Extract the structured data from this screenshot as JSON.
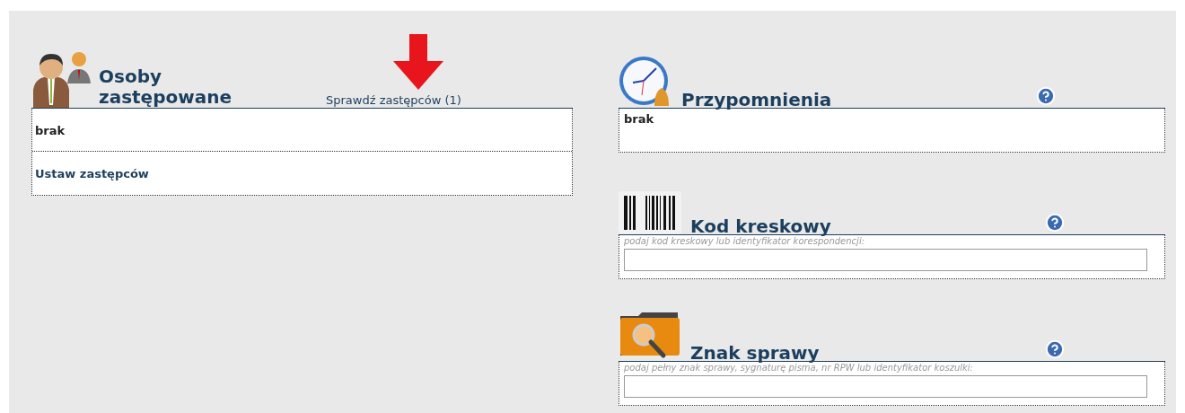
{
  "substitutes": {
    "title": "Osoby zastępowane",
    "check_link": "Sprawdź zastępców (1)",
    "rows": [
      {
        "kind": "text",
        "text": "brak"
      },
      {
        "kind": "link",
        "text": "Ustaw zastępców"
      }
    ]
  },
  "sections": [
    {
      "kind": "reminders",
      "title": "Przypomnienia",
      "text": "brak"
    },
    {
      "kind": "barcode",
      "title": "Kod kreskowy",
      "hint": "podaj kod kreskowy lub identyfikator korespondencji:"
    },
    {
      "kind": "case",
      "title": "Znak sprawy",
      "hint": "podaj pełny znak sprawy, sygnaturę pisma, nr RPW lub identyfikator koszulki:"
    }
  ]
}
